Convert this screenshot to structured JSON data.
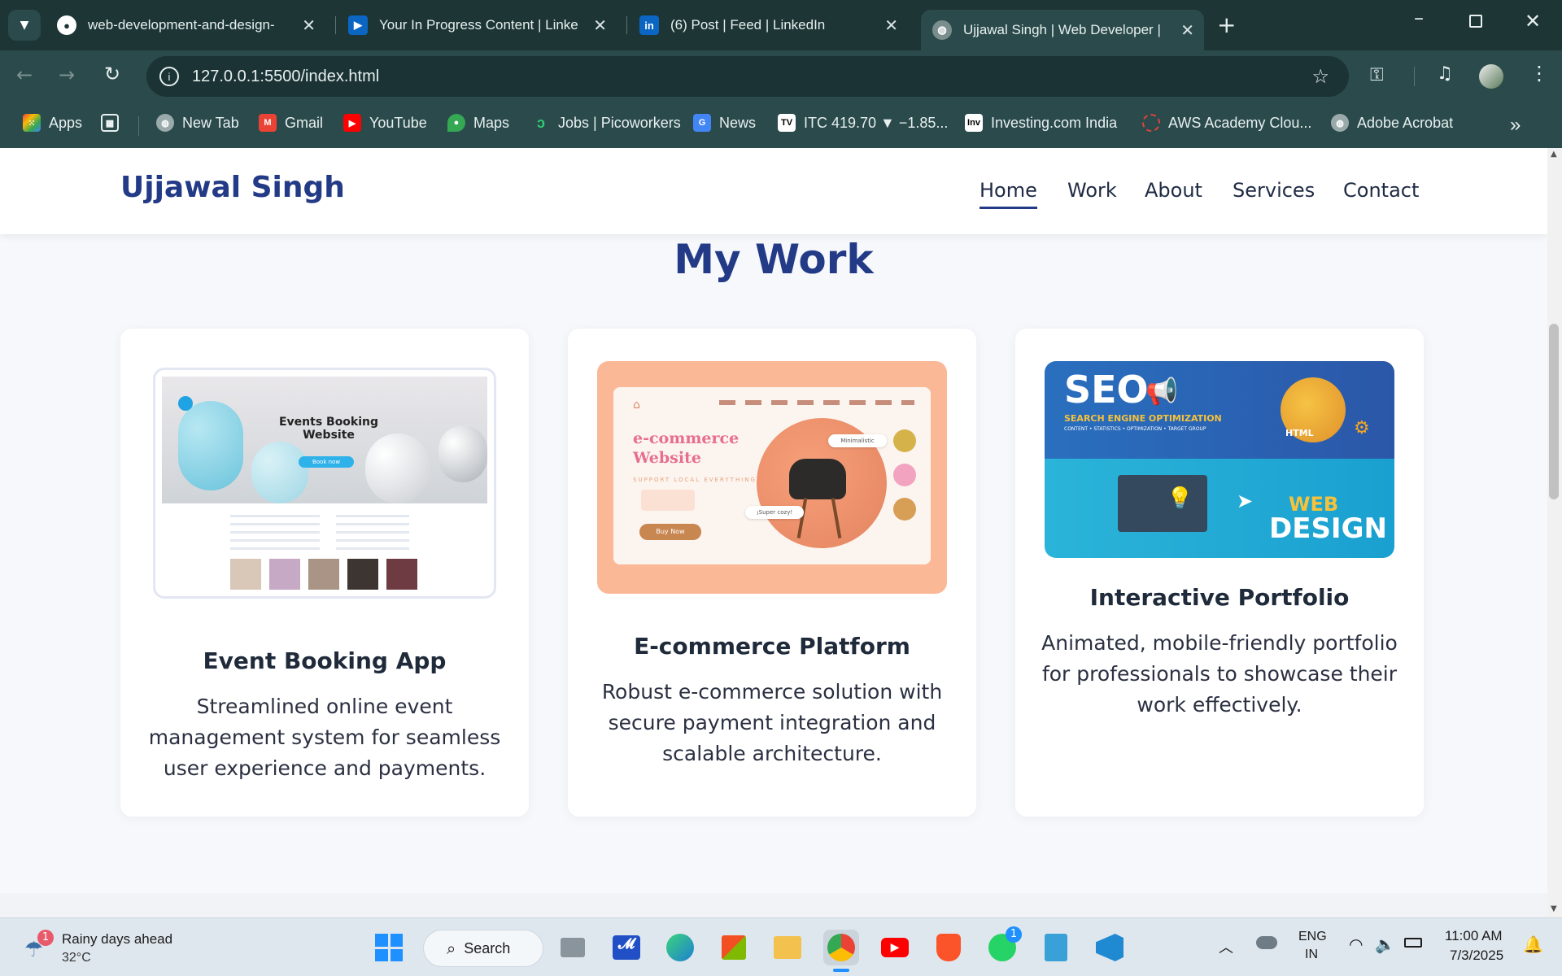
{
  "browser": {
    "tabs": [
      {
        "title": "web-development-and-design-"
      },
      {
        "title": "Your In Progress Content | Linke"
      },
      {
        "title": "(6) Post | Feed | LinkedIn"
      },
      {
        "title": "Ujjawal Singh | Web Developer |"
      }
    ],
    "url": "127.0.0.1:5500/index.html",
    "bookmarks": [
      {
        "label": "Apps"
      },
      {
        "label": "New Tab"
      },
      {
        "label": "Gmail"
      },
      {
        "label": "YouTube"
      },
      {
        "label": "Maps"
      },
      {
        "label": "Jobs | Picoworkers"
      },
      {
        "label": "News"
      },
      {
        "label": "ITC 419.70 ▼ −1.85..."
      },
      {
        "label": "Investing.com India"
      },
      {
        "label": "AWS Academy Clou..."
      },
      {
        "label": "Adobe Acrobat"
      }
    ]
  },
  "site": {
    "logo": "Ujjawal Singh",
    "nav": [
      "Home",
      "Work",
      "About",
      "Services",
      "Contact"
    ],
    "section_title": "My Work",
    "cards": [
      {
        "title": "Event Booking App",
        "description": "Streamlined online event management system for seamless user experience and payments.",
        "thumb": {
          "heading": "Events Booking Website",
          "button": "Book now"
        }
      },
      {
        "title": "E-commerce Platform",
        "description": "Robust e-commerce solution with secure payment integration and scalable architecture.",
        "thumb": {
          "heading1": "e-commerce",
          "heading2": "Website",
          "tag": "SUPPORT LOCAL EVERYTHING",
          "button": "Buy Now",
          "chip1": "Minimalistic",
          "chip2": "¡Super cozy!"
        }
      },
      {
        "title": "Interactive Portfolio",
        "description": "Animated, mobile-friendly portfolio for professionals to showcase their work effectively.",
        "thumb": {
          "seo": "SEO",
          "seo_sub": "SEARCH ENGINE OPTIMIZATION",
          "seo_sub2": "CONTENT • STATISTICS • OPTIMIZATION • TARGET GROUP",
          "web": "WEB",
          "design": "DESIGN",
          "html": "HTML"
        }
      }
    ]
  },
  "taskbar": {
    "weather_badge": "1",
    "weather_title": "Rainy days ahead",
    "weather_temp": "32°C",
    "search": "Search",
    "whatsapp_badge": "1",
    "lang1": "ENG",
    "lang2": "IN",
    "time": "11:00 AM",
    "date": "7/3/2025"
  },
  "colors": {
    "brand": "#233a86",
    "chrome": "#2b4a4b",
    "tabbar": "#1d3535"
  }
}
